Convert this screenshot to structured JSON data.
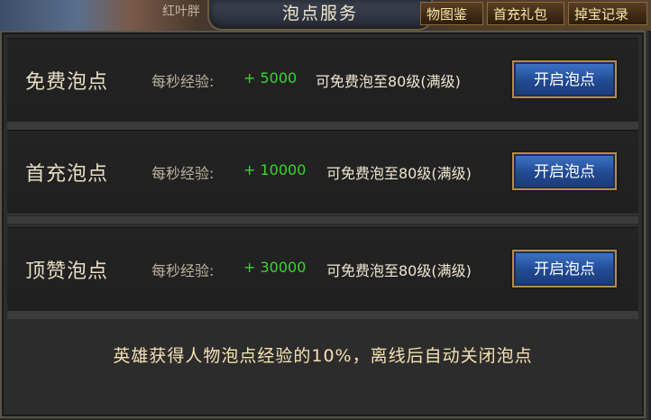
{
  "header": {
    "bg_text": "红叶胖",
    "title": "泡点服务",
    "tabs": [
      {
        "label": "物图鉴"
      },
      {
        "label": "首充礼包"
      },
      {
        "label": "掉宝记录"
      }
    ]
  },
  "rows": [
    {
      "name": "免费泡点",
      "exp_label": "每秒经验:",
      "exp_value": "+ 5000",
      "level_text": "可免费泡至80级(满级)",
      "button_label": "开启泡点"
    },
    {
      "name": "首充泡点",
      "exp_label": "每秒经验:",
      "exp_value": "+ 10000",
      "level_text": "可免费泡至80级(满级)",
      "button_label": "开启泡点"
    },
    {
      "name": "顶赞泡点",
      "exp_label": "每秒经验:",
      "exp_value": "+ 30000",
      "level_text": "可免费泡至80级(满级)",
      "button_label": "开启泡点"
    }
  ],
  "footer": {
    "note": "英雄获得人物泡点经验的10%，离线后自动关闭泡点"
  },
  "colors": {
    "exp_value": "#39d630",
    "button_fill": "#214a93",
    "button_border": "#b58c4a",
    "panel_bg": "#2c2c2c",
    "footer_text": "#f5e2b5"
  }
}
